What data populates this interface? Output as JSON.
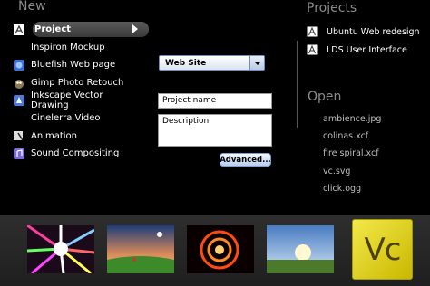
{
  "new_section": {
    "title": "New",
    "items": [
      {
        "label": "Project",
        "icon": "project-icon"
      },
      {
        "label": "Inspiron Mockup",
        "icon": "mockup-icon"
      },
      {
        "label": "Bluefish Web page",
        "icon": "bluefish-icon"
      },
      {
        "label": "Gimp Photo Retouch",
        "icon": "gimp-icon"
      },
      {
        "label": "Inkscape Vector Drawing",
        "icon": "inkscape-icon"
      },
      {
        "label": "Cinelerra Video",
        "icon": ""
      },
      {
        "label": "Animation",
        "icon": "animation-icon"
      },
      {
        "label": "Sound Compositing",
        "icon": "sound-icon"
      }
    ]
  },
  "form": {
    "type_value": "Web Site",
    "project_name_placeholder": "Project name",
    "description_placeholder": "Description",
    "advanced_label": "Advanced..."
  },
  "projects_section": {
    "title": "Projects",
    "items": [
      {
        "label": "Ubuntu Web redesign"
      },
      {
        "label": "LDS User Interface"
      }
    ]
  },
  "open_section": {
    "title": "Open",
    "items": [
      {
        "label": "ambience.jpg"
      },
      {
        "label": "colinas.xcf"
      },
      {
        "label": "fire spiral.xcf"
      },
      {
        "label": "vc.svg"
      },
      {
        "label": "click.ogg"
      }
    ]
  },
  "bottom_bar": {
    "logo_text": "Vc",
    "thumbnails": [
      "starburst-thumbnail",
      "sunset-field-thumbnail",
      "fire-spiral-thumbnail",
      "sunburst-meadow-thumbnail"
    ]
  }
}
